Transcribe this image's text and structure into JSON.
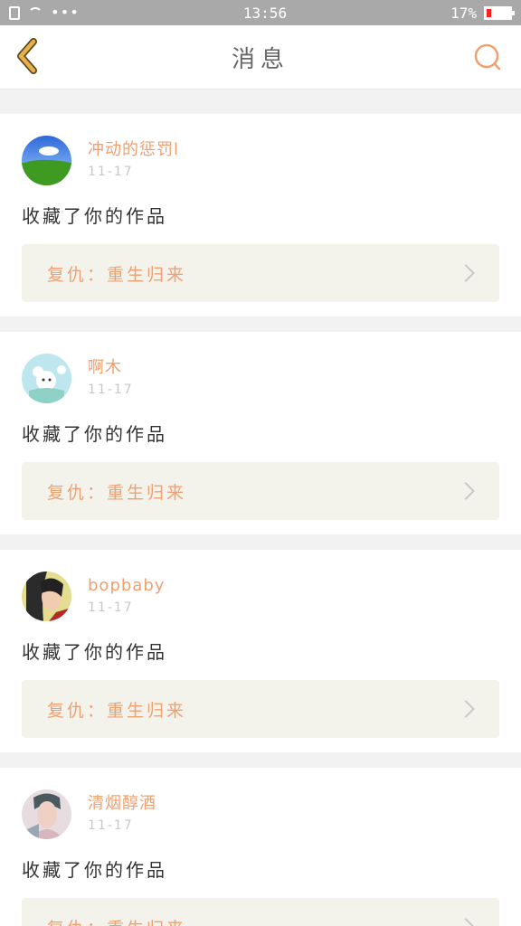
{
  "status_bar": {
    "time": "13:56",
    "battery": "17%",
    "icons": [
      "phone-icon",
      "wifi-icon",
      "more-dots-icon",
      "battery-icon"
    ]
  },
  "header": {
    "title": "消息",
    "back_icon": "back-chevron-icon",
    "search_icon": "search-icon",
    "accent_color": "#e8b04c",
    "search_color": "#f0a070"
  },
  "messages": [
    {
      "username": "冲动的惩罚l",
      "time": "11-17",
      "action": "收藏了你的作品",
      "work_title": "复仇：重生归来"
    },
    {
      "username": "啊木",
      "time": "11-17",
      "action": "收藏了你的作品",
      "work_title": "复仇：重生归来"
    },
    {
      "username": "bopbaby",
      "time": "11-17",
      "action": "收藏了你的作品",
      "work_title": "复仇：重生归来"
    },
    {
      "username": "清烟醇酒",
      "time": "11-17",
      "action": "收藏了你的作品",
      "work_title": "复仇：重生归来"
    }
  ]
}
